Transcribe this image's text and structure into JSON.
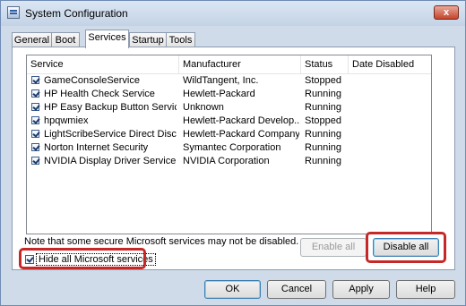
{
  "window": {
    "title": "System Configuration",
    "close_glyph": "x"
  },
  "tabs": [
    "General",
    "Boot",
    "Services",
    "Startup",
    "Tools"
  ],
  "active_tab": "Services",
  "table": {
    "columns": [
      "Service",
      "Manufacturer",
      "Status",
      "Date Disabled"
    ],
    "rows": [
      {
        "checked": true,
        "service": "GameConsoleService",
        "manufacturer": "WildTangent, Inc.",
        "status": "Stopped",
        "date": ""
      },
      {
        "checked": true,
        "service": "HP Health Check Service",
        "manufacturer": "Hewlett-Packard",
        "status": "Running",
        "date": ""
      },
      {
        "checked": true,
        "service": "HP Easy Backup Button Service",
        "manufacturer": "Unknown",
        "status": "Running",
        "date": ""
      },
      {
        "checked": true,
        "service": "hpqwmiex",
        "manufacturer": "Hewlett-Packard Develop...",
        "status": "Stopped",
        "date": ""
      },
      {
        "checked": true,
        "service": "LightScribeService Direct Disc La...",
        "manufacturer": "Hewlett-Packard Company",
        "status": "Running",
        "date": ""
      },
      {
        "checked": true,
        "service": "Norton Internet Security",
        "manufacturer": "Symantec Corporation",
        "status": "Running",
        "date": ""
      },
      {
        "checked": true,
        "service": "NVIDIA Display Driver Service",
        "manufacturer": "NVIDIA Corporation",
        "status": "Running",
        "date": ""
      }
    ]
  },
  "note": "Note that some secure Microsoft services may not be disabled.",
  "hide_ms": {
    "label": "Hide all Microsoft services",
    "checked": true
  },
  "buttons": {
    "enable_all": "Enable all",
    "disable_all": "Disable all",
    "ok": "OK",
    "cancel": "Cancel",
    "apply": "Apply",
    "help": "Help"
  },
  "colors": {
    "highlight": "#c62828",
    "window_frame": "#cfdbe9"
  },
  "icons": {
    "app": "system-config-icon",
    "check": "checkmark-icon",
    "close": "close-icon"
  }
}
